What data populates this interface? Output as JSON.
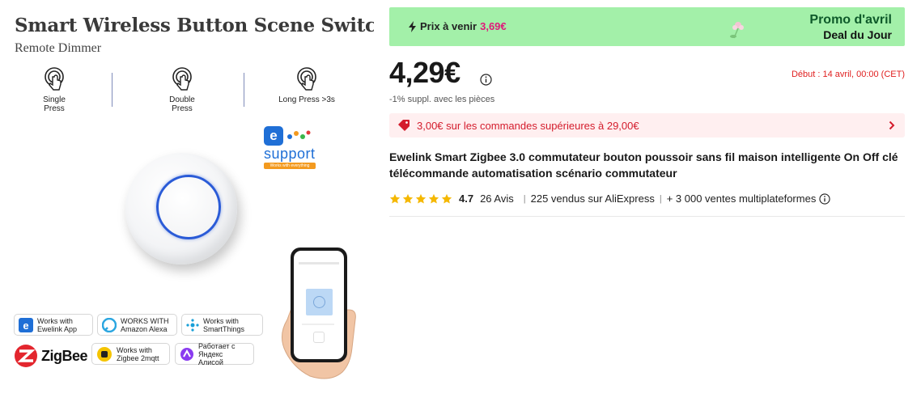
{
  "product_image": {
    "title": "Smart Wireless Button Scene Switch",
    "subtitle": "Remote Dimmer",
    "press_modes": [
      {
        "label": "Single\nPress"
      },
      {
        "label": "Double\nPress"
      },
      {
        "label": "Long Press >3s"
      }
    ],
    "ewelink_support": {
      "logo_letter": "e",
      "word": "support",
      "tagline": "Works with everything"
    },
    "badges": {
      "ewelink": "Works with\nEwelink App",
      "alexa": "WORKS WITH\nAmazon Alexa",
      "smartthings": "Works with\nSmartThings",
      "zigbee_logo": "ZigBee",
      "zigbee2mqtt": "Works with\nZigbee 2mqtt",
      "alice": "Работает с\nЯндекс Алисой"
    },
    "colors": {
      "ring": "#2a5bd7",
      "ewelink_blue": "#1f6fd6",
      "support_orange": "#f39a1f"
    }
  },
  "promo": {
    "upcoming_label": "Prix à venir",
    "upcoming_price": "3,69€",
    "title": "Promo d'avril",
    "subtitle": "Deal du Jour",
    "colors": {
      "background": "#a3f0a9",
      "title": "#0e5a2a",
      "upcoming_price": "#e0187a"
    }
  },
  "pricing": {
    "price": "4,29€",
    "start_date": "Début : 14 avril, 00:00 (CET)",
    "note": "-1% suppl. avec les pièces"
  },
  "coupon": {
    "text": "3,00€ sur les commandes supérieures à 29,00€",
    "colors": {
      "background": "#ffeff0",
      "text": "#d41c2c"
    }
  },
  "product": {
    "title": "Ewelink Smart Zigbee 3.0 commutateur bouton poussoir sans fil maison intelligente On Off clé télécommande automatisation scénario commutateur"
  },
  "rating": {
    "stars": 5,
    "score": "4.7",
    "reviews": "26 Avis",
    "sold": "225 vendus sur AliExpress",
    "multi_platform": "+ 3 000 ventes multiplateformes",
    "star_color": "#f5b800"
  }
}
